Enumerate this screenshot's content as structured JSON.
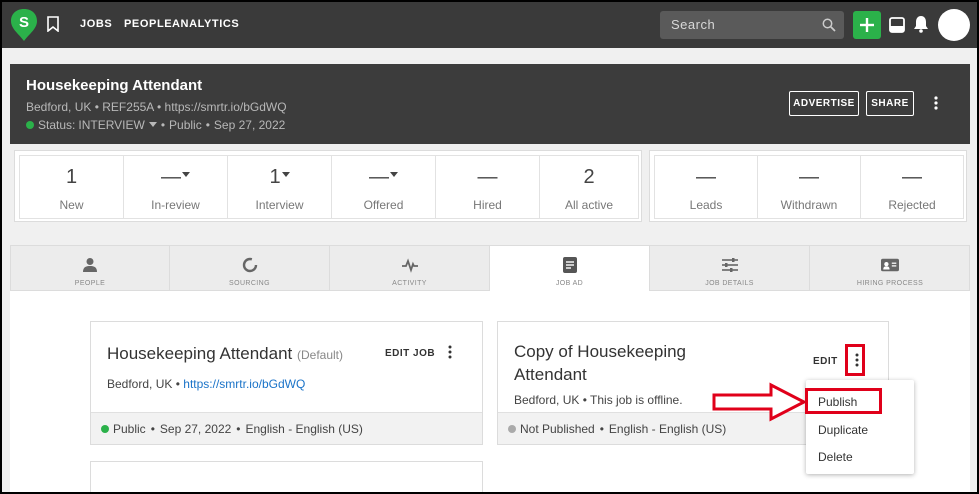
{
  "nav": {
    "logo_letter": "S",
    "links": [
      "JOBS",
      "PEOPLE",
      "ANALYTICS"
    ],
    "search_placeholder": "Search"
  },
  "job": {
    "title": "Housekeeping Attendant",
    "location": "Bedford, UK",
    "ref": "REF255A",
    "url": "https://smrtr.io/bGdWQ",
    "status_prefix": "Status:",
    "status": "INTERVIEW",
    "visibility": "Public",
    "date": "Sep 27, 2022",
    "advertise_label": "ADVERTISE",
    "share_label": "SHARE"
  },
  "stats": [
    {
      "value": "1",
      "label": "New",
      "dropdown": false
    },
    {
      "value": "—",
      "label": "In-review",
      "dropdown": true
    },
    {
      "value": "1",
      "label": "Interview",
      "dropdown": true
    },
    {
      "value": "—",
      "label": "Offered",
      "dropdown": true
    },
    {
      "value": "—",
      "label": "Hired",
      "dropdown": false
    },
    {
      "value": "2",
      "label": "All active",
      "dropdown": false
    }
  ],
  "stats_other": [
    {
      "value": "—",
      "label": "Leads"
    },
    {
      "value": "—",
      "label": "Withdrawn"
    },
    {
      "value": "—",
      "label": "Rejected"
    }
  ],
  "tabs": [
    "PEOPLE",
    "SOURCING",
    "ACTIVITY",
    "JOB AD",
    "JOB DETAILS",
    "HIRING PROCESS"
  ],
  "active_tab": "JOB AD",
  "card1": {
    "title": "Housekeeping Attendant",
    "default_tag": "(Default)",
    "edit_label": "EDIT JOB",
    "location": "Bedford, UK",
    "url": "https://smrtr.io/bGdWQ",
    "status": "Public",
    "date": "Sep 27, 2022",
    "language": "English - English (US)"
  },
  "card2": {
    "title_line1": "Copy of Housekeeping",
    "title_line2": "Attendant",
    "edit_label": "EDIT",
    "location": "Bedford, UK",
    "offline_text": "This job is offline.",
    "status": "Not Published",
    "language": "English - English (US)"
  },
  "menu": {
    "items": [
      "Publish",
      "Duplicate",
      "Delete"
    ]
  },
  "colors": {
    "accent_green": "#2bb14a",
    "highlight_red": "#e0001a",
    "link_blue": "#1a73c8"
  }
}
